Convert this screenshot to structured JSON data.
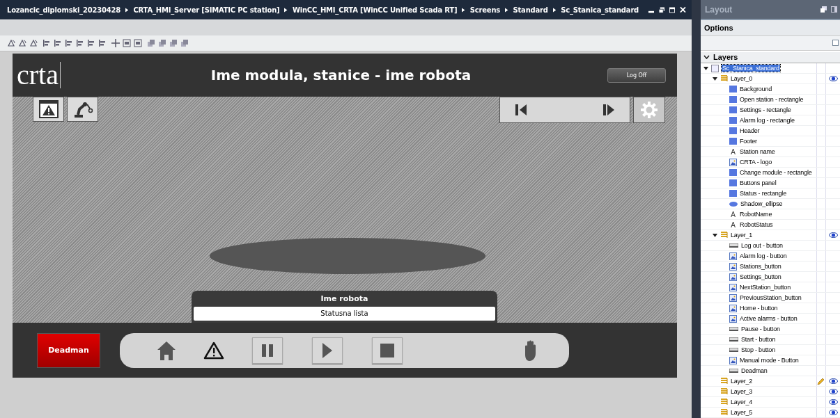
{
  "breadcrumb": [
    "Lozancic_diplomski_20230428",
    "CRTA_HMI_Server [SIMATIC PC station]",
    "WinCC_HMI_CRTA [WinCC Unified Scada RT]",
    "Screens",
    "Standard",
    "Sc_Stanica_standard"
  ],
  "hmi": {
    "logo": "crta",
    "title": "Ime modula, stanice - ime robota",
    "logoff": "Log Off",
    "robot_name": "Ime robota",
    "status": "Statusna lista",
    "deadman": "Deadman"
  },
  "layout_panel": {
    "title": "Layout",
    "options": "Options",
    "layers": "Layers",
    "tree": {
      "label": "Sc_Stanica_standard",
      "selected": true,
      "children": [
        {
          "label": "Layer_0",
          "kind": "layer",
          "visible": true,
          "active": false,
          "children": [
            {
              "label": "Background",
              "kind": "rectangle"
            },
            {
              "label": "Open station - rectangle",
              "kind": "rectangle"
            },
            {
              "label": "Settings - rectangle",
              "kind": "rectangle"
            },
            {
              "label": "Alarm log - rectangle",
              "kind": "rectangle"
            },
            {
              "label": "Header",
              "kind": "rectangle"
            },
            {
              "label": "Footer",
              "kind": "rectangle"
            },
            {
              "label": "Station name",
              "kind": "text",
              "icon": "A"
            },
            {
              "label": "CRTA - logo",
              "kind": "image"
            },
            {
              "label": "Change module - rectangle",
              "kind": "rectangle"
            },
            {
              "label": "Buttons panel",
              "kind": "rectangle"
            },
            {
              "label": "Status - rectangle",
              "kind": "rectangle"
            },
            {
              "label": "Shadow_ellipse",
              "kind": "ellipse"
            },
            {
              "label": "RobotName",
              "kind": "text",
              "icon": "A"
            },
            {
              "label": "RobotStatus",
              "kind": "text",
              "icon": "A"
            }
          ]
        },
        {
          "label": "Layer_1",
          "kind": "layer",
          "visible": true,
          "active": false,
          "children": [
            {
              "label": "Log out - button",
              "kind": "button"
            },
            {
              "label": "Alarm log - button",
              "kind": "image"
            },
            {
              "label": "Stations_button",
              "kind": "image"
            },
            {
              "label": "Settings_button",
              "kind": "image"
            },
            {
              "label": "NextStation_button",
              "kind": "image"
            },
            {
              "label": "PreviousStation_button",
              "kind": "image"
            },
            {
              "label": "Home - button",
              "kind": "image"
            },
            {
              "label": "Active alarms - button",
              "kind": "image"
            },
            {
              "label": "Pause - button",
              "kind": "button"
            },
            {
              "label": "Start - button",
              "kind": "button"
            },
            {
              "label": "Stop - button",
              "kind": "button"
            },
            {
              "label": "Manual mode - Button",
              "kind": "image"
            },
            {
              "label": "Deadman",
              "kind": "button"
            }
          ]
        },
        {
          "label": "Layer_2",
          "kind": "layer",
          "visible": true,
          "active": true
        },
        {
          "label": "Layer_3",
          "kind": "layer",
          "visible": true,
          "active": false
        },
        {
          "label": "Layer_4",
          "kind": "layer",
          "visible": true,
          "active": false
        },
        {
          "label": "Layer_5",
          "kind": "layer",
          "visible": true,
          "active": false
        }
      ]
    }
  }
}
